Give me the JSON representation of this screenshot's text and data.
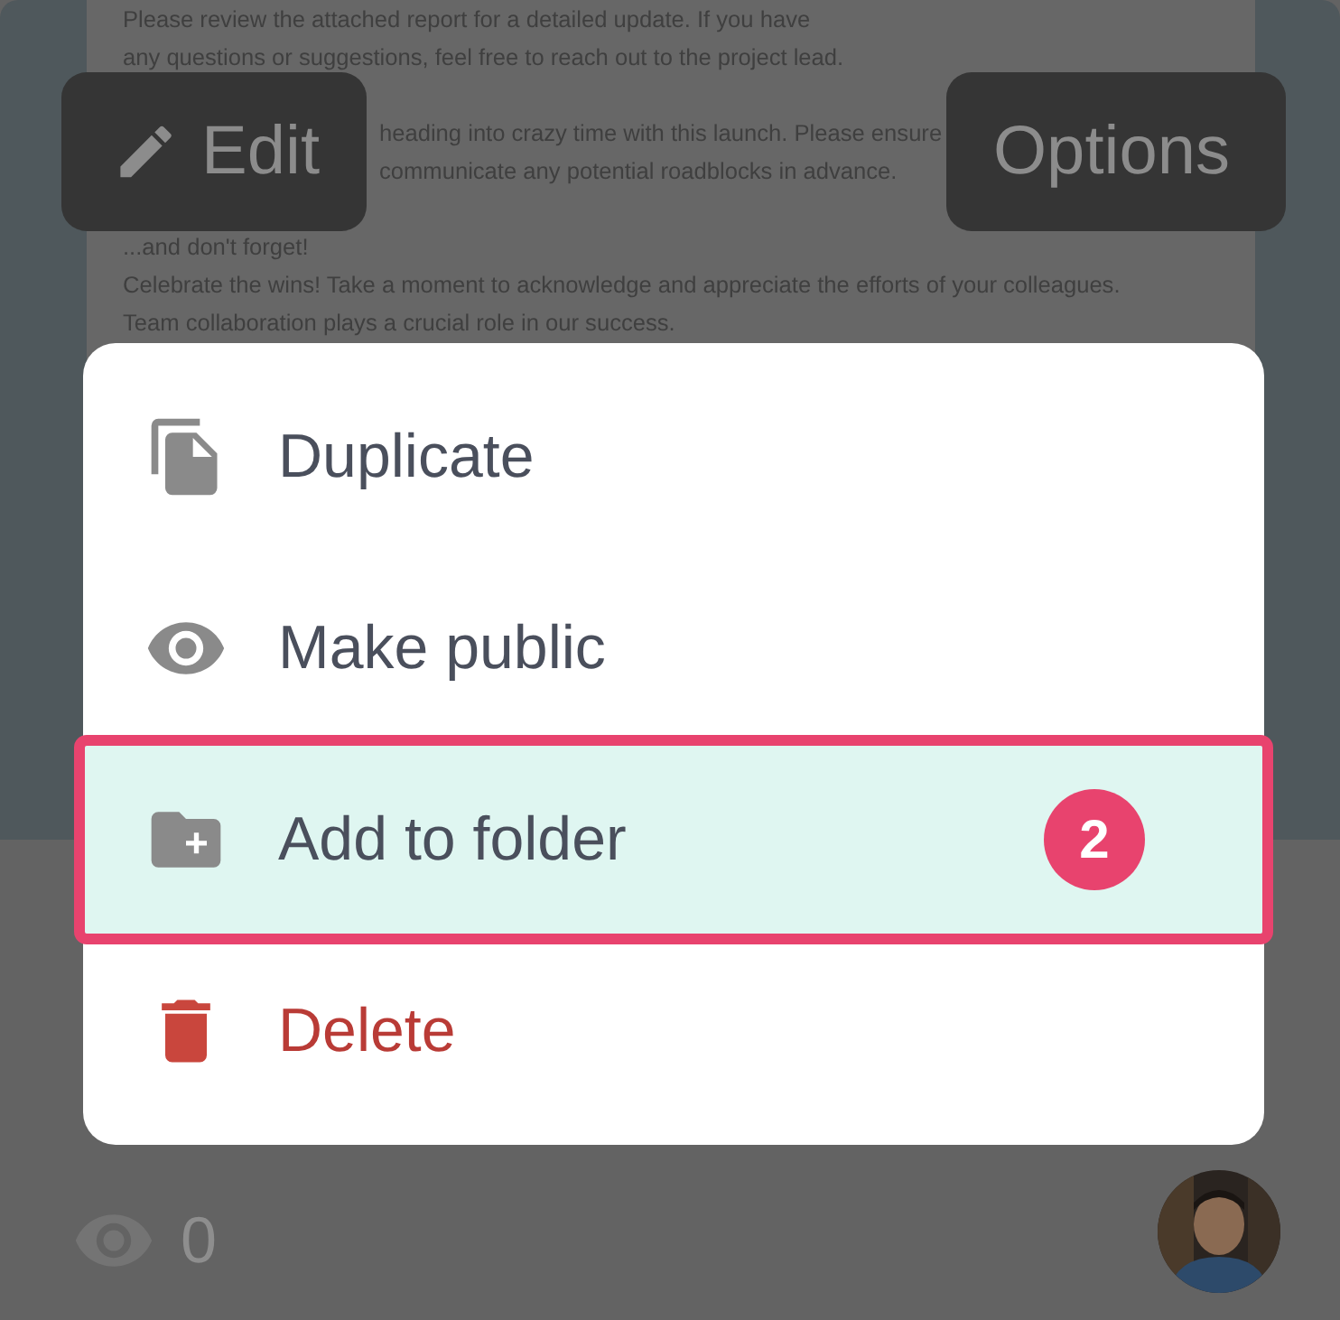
{
  "document": {
    "paragraphs": [
      [
        {
          "text": "Please review the attached report for a detailed update. If you have",
          "kind": "full"
        },
        {
          "text": "any questions or suggestions, feel free to reach out to the project lead.",
          "kind": "full"
        }
      ],
      [
        {
          "text": "heading into crazy time with this launch. Please ensure",
          "kind": "partial"
        },
        {
          "text": "communicate any potential roadblocks in advance.",
          "kind": "partial"
        }
      ],
      [
        {
          "text": "...and don't forget!",
          "kind": "full"
        },
        {
          "text": "Celebrate the wins! Take a moment to acknowledge and appreciate the efforts of your colleagues.",
          "kind": "full"
        },
        {
          "text": "Team collaboration plays a crucial role in our success.",
          "kind": "full"
        }
      ]
    ]
  },
  "toolbar": {
    "edit": "Edit",
    "options": "Options"
  },
  "menu": {
    "items": [
      {
        "label": "Duplicate",
        "kind": "duplicate",
        "selected": false
      },
      {
        "label": "Make public",
        "kind": "public",
        "selected": false
      },
      {
        "label": "Add to folder",
        "kind": "folder",
        "selected": true
      },
      {
        "label": "Delete",
        "kind": "delete",
        "selected": false
      }
    ]
  },
  "step_badge": "2",
  "footer": {
    "views": "0"
  }
}
